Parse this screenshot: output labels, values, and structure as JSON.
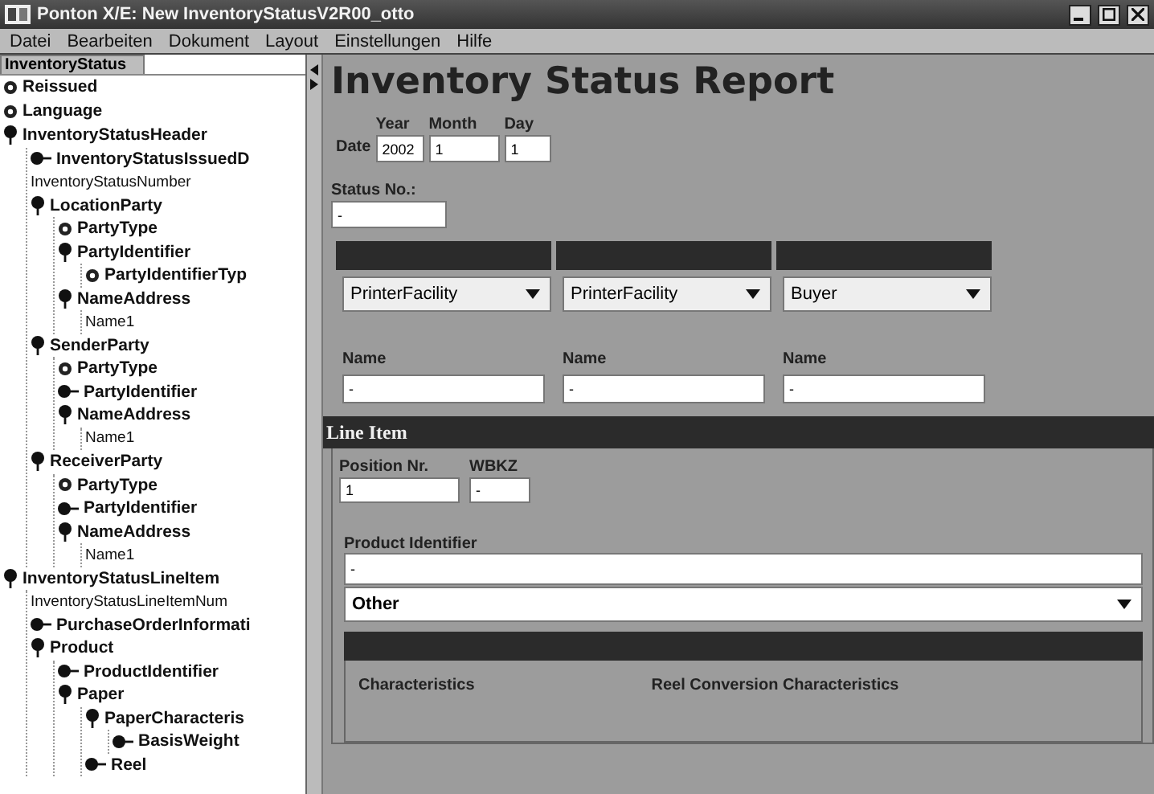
{
  "window": {
    "title": "Ponton X/E: New InventoryStatusV2R00_otto"
  },
  "menu": [
    "Datei",
    "Bearbeiten",
    "Dokument",
    "Layout",
    "Einstellungen",
    "Hilfe"
  ],
  "tree": {
    "tab": "InventoryStatus",
    "nodes": [
      {
        "label": "Reissued",
        "kind": "attribute"
      },
      {
        "label": "Language",
        "kind": "attribute"
      },
      {
        "label": "InventoryStatusHeader",
        "kind": "element",
        "expanded": true,
        "children": [
          {
            "label": "InventoryStatusIssuedD",
            "kind": "element",
            "expanded": false
          },
          {
            "label": "InventoryStatusNumber",
            "kind": "text"
          },
          {
            "label": "LocationParty",
            "kind": "element",
            "expanded": true,
            "children": [
              {
                "label": "PartyType",
                "kind": "attribute"
              },
              {
                "label": "PartyIdentifier",
                "kind": "element",
                "expanded": true,
                "children": [
                  {
                    "label": "PartyIdentifierTyp",
                    "kind": "attribute"
                  }
                ]
              },
              {
                "label": "NameAddress",
                "kind": "element",
                "expanded": true,
                "children": [
                  {
                    "label": "Name1",
                    "kind": "text"
                  }
                ]
              }
            ]
          },
          {
            "label": "SenderParty",
            "kind": "element",
            "expanded": true,
            "children": [
              {
                "label": "PartyType",
                "kind": "attribute"
              },
              {
                "label": "PartyIdentifier",
                "kind": "element",
                "expanded": false
              },
              {
                "label": "NameAddress",
                "kind": "element",
                "expanded": true,
                "children": [
                  {
                    "label": "Name1",
                    "kind": "text"
                  }
                ]
              }
            ]
          },
          {
            "label": "ReceiverParty",
            "kind": "element",
            "expanded": true,
            "children": [
              {
                "label": "PartyType",
                "kind": "attribute"
              },
              {
                "label": "PartyIdentifier",
                "kind": "element",
                "expanded": false
              },
              {
                "label": "NameAddress",
                "kind": "element",
                "expanded": true,
                "children": [
                  {
                    "label": "Name1",
                    "kind": "text"
                  }
                ]
              }
            ]
          }
        ]
      },
      {
        "label": "InventoryStatusLineItem",
        "kind": "element",
        "expanded": true,
        "children": [
          {
            "label": "InventoryStatusLineItemNum",
            "kind": "text"
          },
          {
            "label": "PurchaseOrderInformati",
            "kind": "element",
            "expanded": false
          },
          {
            "label": "Product",
            "kind": "element",
            "expanded": true,
            "children": [
              {
                "label": "ProductIdentifier",
                "kind": "element",
                "expanded": false
              },
              {
                "label": "Paper",
                "kind": "element",
                "expanded": true,
                "children": [
                  {
                    "label": "PaperCharacteris",
                    "kind": "element",
                    "expanded": true,
                    "children": [
                      {
                        "label": "BasisWeight",
                        "kind": "element",
                        "expanded": false
                      }
                    ]
                  },
                  {
                    "label": "Reel",
                    "kind": "element",
                    "expanded": false
                  }
                ]
              }
            ]
          }
        ]
      }
    ]
  },
  "form": {
    "title": "Inventory Status Report",
    "date": {
      "label": "Date",
      "fields": [
        {
          "label": "Year",
          "value": "2002"
        },
        {
          "label": "Month",
          "value": "1"
        },
        {
          "label": "Day",
          "value": "1"
        }
      ]
    },
    "status_no": {
      "label": "Status No.:",
      "value": "-"
    },
    "parties": [
      {
        "type": "PrinterFacility",
        "name_label": "Name",
        "name": "-"
      },
      {
        "type": "PrinterFacility",
        "name_label": "Name",
        "name": "-"
      },
      {
        "type": "Buyer",
        "name_label": "Name",
        "name": "-"
      }
    ],
    "line_item": {
      "title": "Line Item",
      "position": {
        "label": "Position Nr.",
        "value": "1"
      },
      "wbkz": {
        "label": "WBKZ",
        "value": "-"
      },
      "product_identifier": {
        "label": "Product Identifier",
        "value": "-",
        "type": "Other"
      },
      "paper": {
        "characteristics": "Characteristics",
        "reel_conversion": "Reel Conversion Characteristics"
      }
    }
  }
}
